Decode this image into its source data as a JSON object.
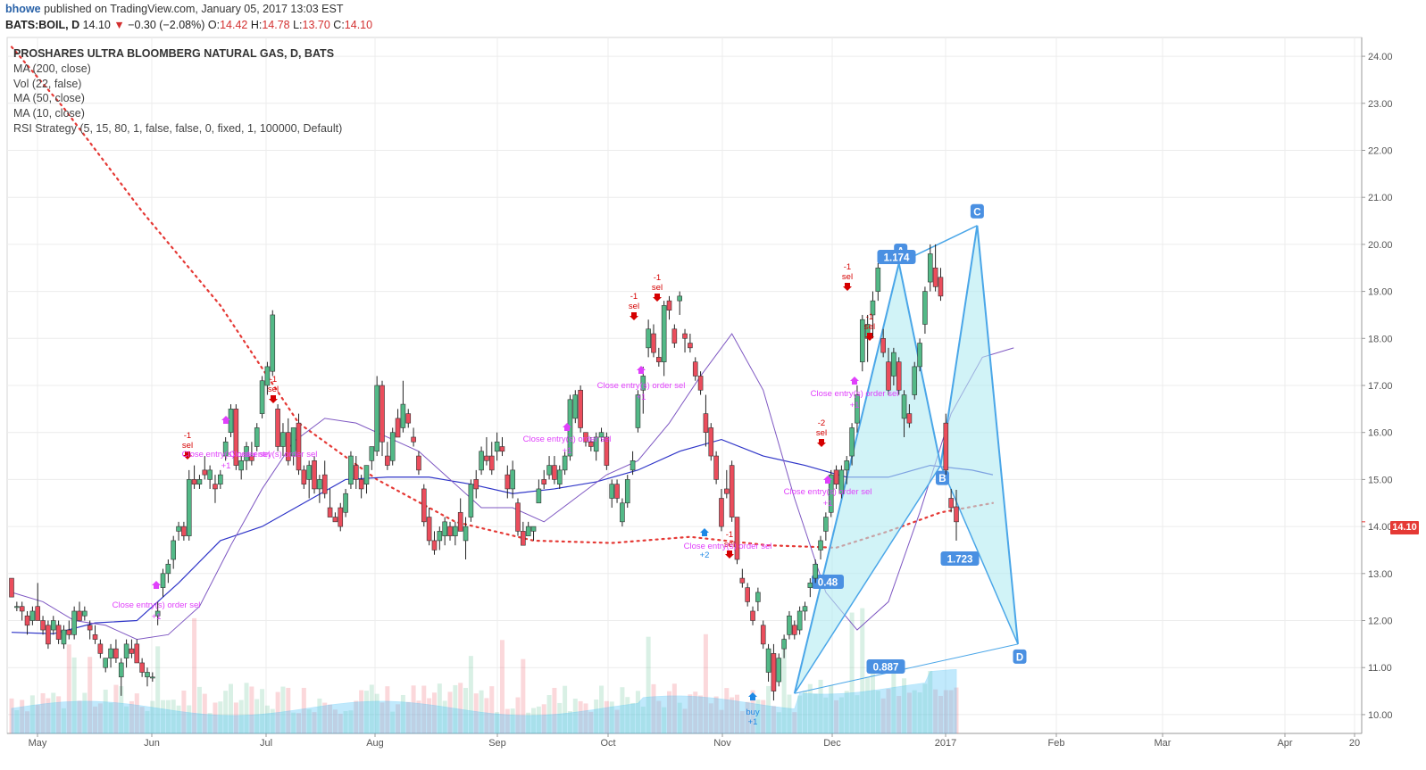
{
  "header": {
    "user": "bhowe",
    "published": "published on TradingView.com, January 05, 2017 13:03 EST",
    "symbol": "BATS:BOIL, D",
    "last": "14.10",
    "change": "−0.30 (−2.08%)",
    "o_label": "O:",
    "o": "14.42",
    "h_label": "H:",
    "h": "14.78",
    "l_label": "L:",
    "l": "13.70",
    "c_label": "C:",
    "c": "14.10"
  },
  "legend": {
    "title": "PROSHARES ULTRA BLOOMBERG NATURAL GAS, D, BATS",
    "items": [
      "MA (200, close)",
      "Vol (22, false)",
      "MA (50, close)",
      "MA (10, close)",
      "RSI Strategy (5, 15, 80, 1, false, false, 0, fixed, 1, 100000, Default)"
    ]
  },
  "price_tag": "14.10",
  "colors": {
    "up": "#53b987",
    "down": "#eb4d5c",
    "ma200": "#e53935",
    "ma50": "#2f35c8",
    "ma10": "#7e57c2",
    "pattern": "#4aa6e8",
    "pattern_fill": "#b2ebf2",
    "strategy": "#e040fb",
    "sell": "#d50000",
    "buy": "#1e88e5"
  },
  "chart_data": {
    "type": "candlestick",
    "yaxis": {
      "min": 9.6,
      "max": 24.4,
      "ticks": [
        "24.00",
        "23.00",
        "22.00",
        "21.00",
        "20.00",
        "19.00",
        "18.00",
        "17.00",
        "16.00",
        "15.00",
        "14.00",
        "13.00",
        "12.00",
        "11.00",
        "10.00"
      ],
      "position": "right"
    },
    "xaxis": {
      "ticks": [
        "May",
        "Jun",
        "Jul",
        "Aug",
        "Sep",
        "Oct",
        "Nov",
        "Dec",
        "2017",
        "Feb",
        "Mar",
        "Apr",
        "20"
      ]
    },
    "grid": true,
    "ohlc": [
      [
        12.9,
        12.9,
        12.5,
        12.5
      ],
      [
        12.3,
        12.4,
        12.2,
        12.3
      ],
      [
        12.3,
        12.4,
        12.0,
        12.2
      ],
      [
        12.1,
        12.2,
        11.7,
        11.9
      ],
      [
        12.0,
        12.3,
        11.9,
        12.2
      ],
      [
        12.3,
        12.8,
        12.1,
        12.0
      ],
      [
        12.0,
        12.1,
        11.7,
        11.8
      ],
      [
        11.9,
        12.0,
        11.4,
        11.5
      ],
      [
        11.8,
        12.1,
        11.7,
        12.0
      ],
      [
        11.9,
        12.0,
        11.5,
        11.6
      ],
      [
        11.5,
        11.9,
        11.4,
        11.8
      ],
      [
        11.8,
        12.0,
        11.6,
        11.7
      ],
      [
        11.7,
        12.3,
        11.6,
        12.2
      ],
      [
        12.2,
        12.4,
        12.0,
        12.0
      ],
      [
        12.1,
        12.3,
        12.0,
        12.2
      ],
      [
        11.9,
        12.0,
        11.6,
        11.8
      ],
      [
        11.7,
        11.9,
        11.5,
        11.6
      ],
      [
        11.5,
        11.6,
        11.2,
        11.3
      ],
      [
        11.0,
        11.2,
        10.9,
        11.2
      ],
      [
        11.2,
        11.5,
        11.0,
        11.4
      ],
      [
        11.4,
        11.6,
        11.1,
        11.2
      ],
      [
        10.8,
        11.2,
        10.4,
        11.1
      ],
      [
        11.2,
        11.6,
        11.0,
        11.5
      ],
      [
        11.4,
        11.6,
        11.2,
        11.3
      ],
      [
        11.5,
        11.6,
        11.1,
        11.1
      ],
      [
        11.1,
        11.2,
        10.8,
        10.9
      ],
      [
        10.8,
        11.0,
        10.6,
        10.9
      ],
      [
        10.8,
        10.9,
        10.7,
        10.8
      ],
      [
        12.1,
        12.4,
        11.9,
        12.2
      ],
      [
        12.7,
        13.1,
        12.5,
        13.0
      ],
      [
        13.0,
        13.3,
        12.8,
        13.2
      ],
      [
        13.3,
        13.8,
        13.1,
        13.7
      ],
      [
        13.9,
        14.1,
        13.7,
        14.0
      ],
      [
        14.0,
        14.1,
        13.7,
        13.8
      ],
      [
        13.8,
        15.2,
        13.7,
        15.0
      ],
      [
        15.0,
        15.3,
        14.8,
        14.9
      ],
      [
        14.9,
        15.1,
        14.8,
        15.0
      ],
      [
        15.2,
        15.5,
        15.0,
        15.1
      ],
      [
        15.0,
        15.3,
        14.8,
        15.2
      ],
      [
        14.9,
        15.1,
        14.5,
        14.8
      ],
      [
        14.9,
        15.2,
        14.8,
        15.1
      ],
      [
        15.5,
        15.9,
        15.4,
        15.8
      ],
      [
        16.0,
        16.6,
        15.9,
        16.5
      ],
      [
        16.5,
        16.6,
        15.2,
        15.3
      ],
      [
        15.2,
        15.5,
        15.0,
        15.4
      ],
      [
        15.4,
        15.8,
        15.2,
        15.7
      ],
      [
        15.5,
        15.8,
        15.3,
        15.4
      ],
      [
        15.7,
        16.2,
        15.6,
        16.1
      ],
      [
        16.4,
        17.2,
        16.3,
        17.1
      ],
      [
        17.0,
        17.5,
        16.8,
        17.4
      ],
      [
        17.3,
        18.6,
        17.2,
        18.5
      ],
      [
        16.5,
        16.6,
        15.6,
        15.7
      ],
      [
        15.7,
        16.2,
        15.5,
        16.0
      ],
      [
        16.0,
        16.3,
        15.3,
        15.4
      ],
      [
        15.5,
        16.1,
        15.3,
        16.1
      ],
      [
        16.2,
        16.4,
        15.1,
        15.2
      ],
      [
        15.2,
        15.3,
        14.8,
        14.9
      ],
      [
        15.0,
        15.4,
        14.6,
        15.3
      ],
      [
        15.4,
        15.5,
        14.7,
        14.8
      ],
      [
        14.8,
        15.1,
        14.5,
        15.0
      ],
      [
        15.1,
        15.4,
        14.6,
        14.7
      ],
      [
        14.4,
        14.8,
        14.3,
        14.2
      ],
      [
        14.2,
        14.3,
        14.1,
        14.1
      ],
      [
        14.4,
        14.5,
        13.9,
        14.0
      ],
      [
        14.3,
        14.8,
        14.2,
        14.7
      ],
      [
        14.9,
        15.6,
        14.8,
        15.5
      ],
      [
        15.3,
        15.5,
        14.8,
        15.0
      ],
      [
        15.0,
        15.1,
        14.6,
        14.8
      ],
      [
        14.9,
        15.3,
        14.7,
        15.3
      ],
      [
        15.4,
        15.7,
        15.2,
        15.7
      ],
      [
        15.6,
        17.2,
        15.5,
        17.0
      ],
      [
        17.0,
        17.1,
        15.5,
        15.8
      ],
      [
        15.5,
        15.8,
        15.2,
        15.3
      ],
      [
        15.4,
        16.1,
        15.3,
        16.0
      ],
      [
        16.3,
        16.5,
        15.9,
        15.9
      ],
      [
        16.1,
        17.1,
        16.0,
        16.6
      ],
      [
        16.4,
        16.5,
        16.1,
        16.2
      ],
      [
        15.9,
        16.1,
        15.7,
        15.8
      ],
      [
        15.5,
        15.6,
        15.1,
        15.2
      ],
      [
        14.8,
        14.9,
        14.0,
        14.1
      ],
      [
        14.2,
        14.4,
        13.6,
        13.7
      ],
      [
        13.7,
        13.9,
        13.4,
        13.5
      ],
      [
        13.7,
        14.0,
        13.5,
        13.9
      ],
      [
        13.8,
        14.2,
        13.6,
        14.1
      ],
      [
        14.0,
        14.1,
        13.7,
        13.8
      ],
      [
        13.8,
        14.1,
        13.6,
        14.0
      ],
      [
        14.3,
        14.6,
        13.9,
        13.9
      ],
      [
        13.7,
        14.2,
        13.3,
        14.0
      ],
      [
        14.2,
        15.0,
        14.1,
        14.9
      ],
      [
        15.0,
        15.2,
        14.6,
        14.8
      ],
      [
        15.2,
        15.7,
        15.1,
        15.6
      ],
      [
        15.5,
        15.9,
        15.3,
        15.4
      ],
      [
        15.5,
        15.8,
        15.1,
        15.2
      ],
      [
        15.6,
        16.0,
        15.4,
        15.8
      ],
      [
        15.7,
        15.9,
        15.5,
        15.6
      ],
      [
        15.1,
        15.3,
        14.6,
        14.8
      ],
      [
        14.8,
        15.4,
        14.6,
        15.2
      ],
      [
        14.5,
        14.6,
        13.8,
        13.9
      ],
      [
        13.9,
        14.1,
        13.6,
        13.6
      ],
      [
        13.8,
        14.1,
        13.8,
        14.0
      ],
      [
        13.9,
        14.0,
        13.7,
        14.0
      ],
      [
        14.5,
        15.0,
        14.5,
        14.8
      ],
      [
        15.0,
        15.2,
        14.8,
        14.9
      ],
      [
        15.1,
        15.5,
        15.0,
        15.3
      ],
      [
        15.3,
        15.5,
        14.9,
        15.0
      ],
      [
        14.9,
        15.3,
        14.8,
        15.2
      ],
      [
        15.2,
        15.6,
        15.1,
        15.5
      ],
      [
        15.5,
        16.8,
        15.4,
        16.7
      ],
      [
        16.3,
        16.9,
        16.2,
        16.8
      ],
      [
        16.9,
        17.0,
        16.0,
        16.1
      ],
      [
        16.0,
        16.0,
        15.7,
        15.8
      ],
      [
        15.8,
        15.9,
        15.6,
        15.7
      ],
      [
        15.6,
        16.0,
        15.4,
        15.9
      ],
      [
        15.9,
        16.1,
        15.8,
        16.0
      ],
      [
        15.9,
        16.0,
        15.2,
        15.3
      ],
      [
        14.6,
        15.0,
        14.4,
        14.9
      ],
      [
        14.9,
        15.0,
        14.5,
        14.6
      ],
      [
        14.1,
        14.6,
        14.0,
        14.5
      ],
      [
        14.5,
        15.1,
        14.4,
        15.0
      ],
      [
        15.2,
        15.6,
        15.1,
        15.4
      ],
      [
        16.1,
        16.9,
        16.0,
        16.8
      ],
      [
        16.9,
        17.4,
        16.4,
        17.2
      ],
      [
        17.8,
        18.4,
        17.6,
        18.2
      ],
      [
        18.1,
        18.3,
        17.6,
        17.7
      ],
      [
        17.6,
        17.8,
        17.4,
        17.5
      ],
      [
        17.5,
        18.8,
        17.2,
        18.7
      ],
      [
        18.8,
        18.9,
        18.4,
        18.6
      ],
      [
        18.2,
        18.3,
        17.8,
        17.9
      ],
      [
        18.8,
        19.0,
        18.5,
        18.9
      ],
      [
        18.1,
        18.2,
        17.7,
        18.0
      ],
      [
        17.9,
        18.1,
        17.7,
        17.8
      ],
      [
        17.5,
        17.6,
        17.1,
        17.2
      ],
      [
        17.2,
        17.3,
        16.8,
        16.9
      ],
      [
        16.4,
        16.8,
        15.7,
        16.0
      ],
      [
        16.1,
        16.2,
        15.4,
        15.5
      ],
      [
        15.5,
        15.6,
        14.9,
        15.0
      ],
      [
        14.6,
        14.8,
        13.9,
        14.0
      ],
      [
        14.8,
        15.2,
        14.6,
        14.7
      ],
      [
        15.3,
        15.4,
        14.1,
        14.2
      ],
      [
        14.2,
        14.2,
        13.2,
        13.3
      ],
      [
        12.9,
        13.1,
        12.7,
        12.8
      ],
      [
        12.7,
        12.8,
        12.3,
        12.4
      ],
      [
        12.2,
        12.3,
        11.9,
        12.0
      ],
      [
        12.4,
        12.7,
        12.2,
        12.6
      ],
      [
        11.9,
        12.0,
        11.4,
        11.5
      ],
      [
        10.9,
        11.5,
        10.7,
        11.4
      ],
      [
        11.3,
        11.5,
        10.3,
        10.5
      ],
      [
        10.7,
        11.3,
        10.6,
        11.2
      ],
      [
        11.4,
        11.7,
        11.2,
        11.6
      ],
      [
        11.7,
        12.2,
        11.6,
        12.1
      ],
      [
        11.9,
        12.0,
        11.6,
        11.7
      ],
      [
        11.8,
        12.3,
        11.7,
        12.2
      ],
      [
        12.2,
        12.4,
        12.0,
        12.3
      ],
      [
        12.7,
        12.9,
        12.5,
        12.8
      ],
      [
        12.9,
        13.3,
        12.8,
        13.2
      ],
      [
        13.5,
        13.8,
        13.3,
        13.7
      ],
      [
        13.9,
        14.3,
        13.7,
        14.2
      ],
      [
        14.3,
        15.2,
        14.2,
        15.1
      ],
      [
        15.2,
        15.3,
        14.8,
        14.9
      ],
      [
        14.7,
        15.3,
        14.6,
        15.2
      ],
      [
        15.2,
        15.5,
        14.9,
        15.4
      ],
      [
        15.5,
        16.2,
        15.3,
        16.1
      ],
      [
        16.2,
        17.0,
        16.0,
        16.8
      ],
      [
        17.5,
        18.5,
        17.3,
        18.4
      ],
      [
        18.0,
        18.5,
        17.5,
        18.3
      ],
      [
        18.5,
        19.0,
        18.0,
        18.8
      ],
      [
        19.0,
        19.6,
        18.8,
        19.5
      ],
      [
        18.0,
        18.2,
        17.6,
        17.7
      ],
      [
        17.5,
        17.8,
        16.8,
        16.9
      ],
      [
        17.2,
        17.8,
        17.0,
        17.7
      ],
      [
        17.5,
        17.6,
        16.8,
        16.9
      ],
      [
        16.3,
        16.9,
        15.9,
        16.8
      ],
      [
        16.4,
        16.6,
        16.1,
        16.2
      ],
      [
        16.8,
        17.5,
        16.7,
        17.4
      ],
      [
        17.4,
        18.0,
        17.3,
        17.9
      ],
      [
        18.3,
        19.1,
        18.1,
        19.0
      ],
      [
        19.2,
        20.0,
        19.0,
        19.8
      ],
      [
        19.5,
        20.0,
        19.0,
        19.1
      ],
      [
        19.3,
        19.5,
        18.8,
        18.9
      ],
      [
        16.2,
        16.4,
        15.1,
        15.2
      ],
      [
        14.6,
        14.8,
        14.3,
        14.4
      ],
      [
        14.42,
        14.78,
        13.7,
        14.1
      ]
    ],
    "ma200": [
      [
        0,
        24.2
      ],
      [
        10,
        22.9
      ],
      [
        25,
        20.7
      ],
      [
        40,
        18.7
      ],
      [
        55,
        16.2
      ],
      [
        70,
        15.0
      ],
      [
        85,
        14.1
      ],
      [
        100,
        13.7
      ],
      [
        115,
        13.65
      ],
      [
        130,
        13.78
      ],
      [
        145,
        13.6
      ],
      [
        158,
        13.55
      ],
      [
        168,
        13.9
      ],
      [
        178,
        14.3
      ],
      [
        188,
        14.5
      ]
    ],
    "ma50": [
      [
        0,
        11.75
      ],
      [
        8,
        11.72
      ],
      [
        16,
        11.95
      ],
      [
        24,
        12.0
      ],
      [
        32,
        12.8
      ],
      [
        40,
        13.7
      ],
      [
        48,
        14.0
      ],
      [
        56,
        14.5
      ],
      [
        64,
        15.0
      ],
      [
        72,
        15.05
      ],
      [
        80,
        15.05
      ],
      [
        88,
        14.9
      ],
      [
        96,
        14.7
      ],
      [
        104,
        14.8
      ],
      [
        112,
        14.95
      ],
      [
        120,
        15.2
      ],
      [
        128,
        15.6
      ],
      [
        136,
        15.85
      ],
      [
        144,
        15.5
      ],
      [
        152,
        15.3
      ],
      [
        160,
        15.05
      ],
      [
        168,
        15.05
      ],
      [
        176,
        15.3
      ],
      [
        184,
        15.2
      ],
      [
        188,
        15.1
      ]
    ],
    "ma10": [
      [
        0,
        12.6
      ],
      [
        6,
        12.4
      ],
      [
        12,
        12.0
      ],
      [
        18,
        11.9
      ],
      [
        24,
        11.6
      ],
      [
        30,
        11.7
      ],
      [
        36,
        12.3
      ],
      [
        42,
        13.6
      ],
      [
        48,
        14.8
      ],
      [
        54,
        15.8
      ],
      [
        60,
        16.3
      ],
      [
        66,
        16.2
      ],
      [
        72,
        15.9
      ],
      [
        78,
        15.6
      ],
      [
        84,
        15.0
      ],
      [
        90,
        14.4
      ],
      [
        96,
        14.4
      ],
      [
        102,
        14.1
      ],
      [
        108,
        14.6
      ],
      [
        114,
        15.1
      ],
      [
        120,
        15.4
      ],
      [
        126,
        16.2
      ],
      [
        132,
        17.2
      ],
      [
        138,
        18.1
      ],
      [
        144,
        16.9
      ],
      [
        150,
        14.6
      ],
      [
        156,
        12.6
      ],
      [
        162,
        11.8
      ],
      [
        168,
        12.4
      ],
      [
        174,
        14.3
      ],
      [
        180,
        16.4
      ],
      [
        186,
        17.6
      ],
      [
        192,
        17.8
      ]
    ],
    "pattern": {
      "X": [
        0,
        10.45
      ],
      "A": [
        0,
        19.6
      ],
      "B": [
        0,
        15.3
      ],
      "C": [
        0,
        20.4
      ],
      "D": [
        0,
        11.5
      ],
      "ratios": [
        "0.48",
        "1.174",
        "1.723",
        "0.887"
      ],
      "labels": [
        "A",
        "B",
        "C",
        "D"
      ]
    },
    "annotations": {
      "sell": [
        "-1",
        "sel",
        "-2",
        "sel"
      ],
      "close": [
        "Close entry(s) order sel",
        "+1"
      ],
      "buy": [
        "+2",
        "buy",
        "+1"
      ]
    }
  }
}
